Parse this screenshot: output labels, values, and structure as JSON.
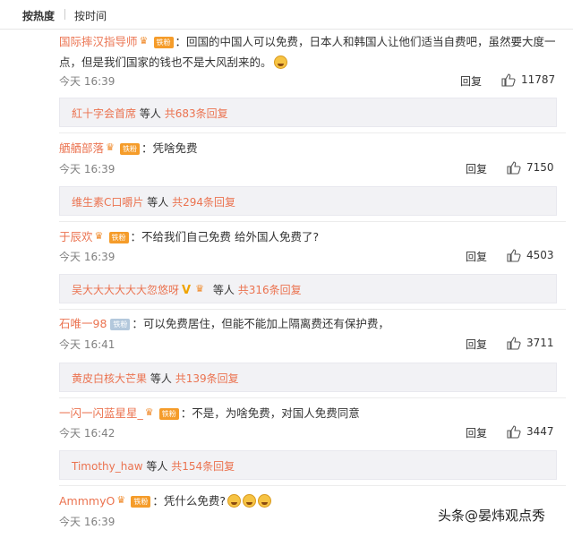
{
  "sort": {
    "hot": "按热度",
    "time": "按时间"
  },
  "reply_label": "回复",
  "more_prefix": "等人",
  "comments": [
    {
      "user": "国际摔汉指导师",
      "badge": "铁粉",
      "text": "：回国的中国人可以免费，日本人和韩国人让他们适当自费吧，虽然要大度一点，但是我们国家的钱也不是大风刮来的。",
      "time": "今天 16:39",
      "likes": "11787",
      "sub": {
        "user": "紅十字会首席",
        "more": "共683条回复"
      }
    },
    {
      "user": "舾舾部落",
      "badge": "铁粉",
      "text": "：凭啥免费",
      "time": "今天 16:39",
      "likes": "7150",
      "sub": {
        "user": "维生素C口嚼片",
        "more": "共294条回复"
      }
    },
    {
      "user": "于辰欢",
      "badge": "铁粉",
      "text": "：不给我们自己免费 给外国人免费了?",
      "time": "今天 16:39",
      "likes": "4503",
      "sub": {
        "user": "吴大大大大大大忽悠呀",
        "more": "共316条回复"
      }
    },
    {
      "user": "石唯一98",
      "badge": "铁粉",
      "text": "：可以免费居住，但能不能加上隔离费还有保护费，",
      "time": "今天 16:41",
      "likes": "3711",
      "sub": {
        "user": "黄皮白核大芒果",
        "more": "共139条回复"
      }
    },
    {
      "user": "一闪一闪蓝星星_",
      "badge": "铁粉",
      "text": "：不是，为啥免费，对国人免费同意",
      "time": "今天 16:42",
      "likes": "3447",
      "sub": {
        "user": "Timothy_haw",
        "more": "共154条回复"
      }
    },
    {
      "user": "AmmmyO",
      "badge": "铁粉",
      "text": "：凭什么免费?",
      "time": "今天 16:39"
    }
  ],
  "watermark": {
    "text": "头条",
    "at": "@",
    "author": "晏炜观点秀"
  },
  "icons": {
    "like": "thumbs-up-icon",
    "crown": "crown-icon",
    "emoji": "laugh-emoji-icon",
    "verified": "verified-v-icon"
  },
  "colors": {
    "username": "#eb7350",
    "subbox_bg": "#f2f2f5",
    "badge": "#f59c2a"
  }
}
